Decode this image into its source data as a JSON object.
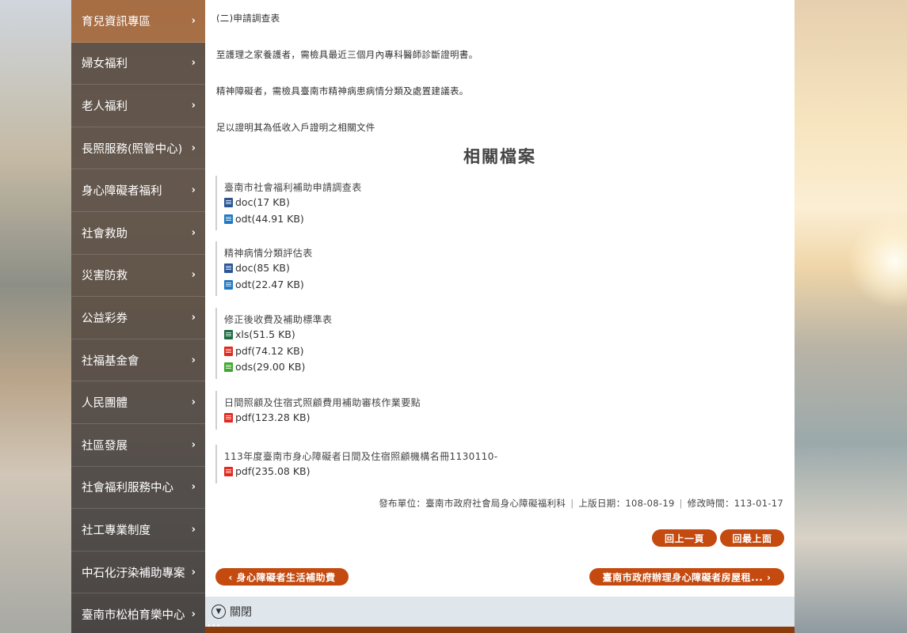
{
  "sidebar": {
    "items": [
      {
        "label": "育兒資訊專區"
      },
      {
        "label": "婦女福利"
      },
      {
        "label": "老人福利"
      },
      {
        "label": "長照服務(照管中心)"
      },
      {
        "label": "身心障礙者福利"
      },
      {
        "label": "社會救助"
      },
      {
        "label": "災害防救"
      },
      {
        "label": "公益彩券"
      },
      {
        "label": "社福基金會"
      },
      {
        "label": "人民團體"
      },
      {
        "label": "社區發展"
      },
      {
        "label": "社會福利服務中心"
      },
      {
        "label": "社工專業制度"
      },
      {
        "label": "中石化汙染補助專案"
      },
      {
        "label": "臺南市松柏育樂中心"
      }
    ],
    "chevron": "›"
  },
  "content": {
    "p1": "(二)申請調查表",
    "p2": "至護理之家養護者，需檢具最近三個月內專科醫師診斷證明書。",
    "p3": "精神障礙者，需檢具臺南市精神病患病情分類及處置建議表。",
    "p4": "足以證明其為低收入戶證明之相關文件"
  },
  "related": {
    "title": "相關檔案",
    "groups": [
      {
        "title": "臺南市社會福利補助申請調查表",
        "files": [
          {
            "icon": "doc",
            "label": "doc(17 KB)"
          },
          {
            "icon": "odt",
            "label": "odt(44.91 KB)"
          }
        ]
      },
      {
        "title": "精神病情分類評估表",
        "files": [
          {
            "icon": "doc",
            "label": "doc(85 KB)"
          },
          {
            "icon": "odt",
            "label": "odt(22.47 KB)"
          }
        ]
      },
      {
        "title": "修正後收費及補助標準表",
        "files": [
          {
            "icon": "xls",
            "label": "xls(51.5 KB)"
          },
          {
            "icon": "pdf",
            "label": "pdf(74.12 KB)"
          },
          {
            "icon": "ods",
            "label": "ods(29.00 KB)"
          }
        ]
      },
      {
        "title": "日間照顧及住宿式照顧費用補助審核作業要點",
        "files": [
          {
            "icon": "pdf",
            "label": "pdf(123.28 KB)"
          }
        ]
      },
      {
        "title": "113年度臺南市身心障礙者日間及住宿照顧機構名冊1130110-",
        "files": [
          {
            "icon": "pdf",
            "label": "pdf(235.08 KB)"
          }
        ]
      }
    ]
  },
  "meta": {
    "publisher": "發布單位：臺南市政府社會局身心障礙福利科",
    "published": "上版日期：108-08-19",
    "modified": "修改時間：113-01-17",
    "sep": "|"
  },
  "nav": {
    "back": "回上一頁",
    "top": "回最上面",
    "prev": "‹ 身心障礙者生活補助費",
    "next": "臺南市政府辦理身心障礙者房屋租... ›"
  },
  "closebar": {
    "label": "關閉",
    "icon": "chevron-down-icon"
  },
  "colors": {
    "accent": "#c44a0f",
    "sidebar_active": "#9b5a2d",
    "bottom_bar": "#8a3c0c"
  }
}
